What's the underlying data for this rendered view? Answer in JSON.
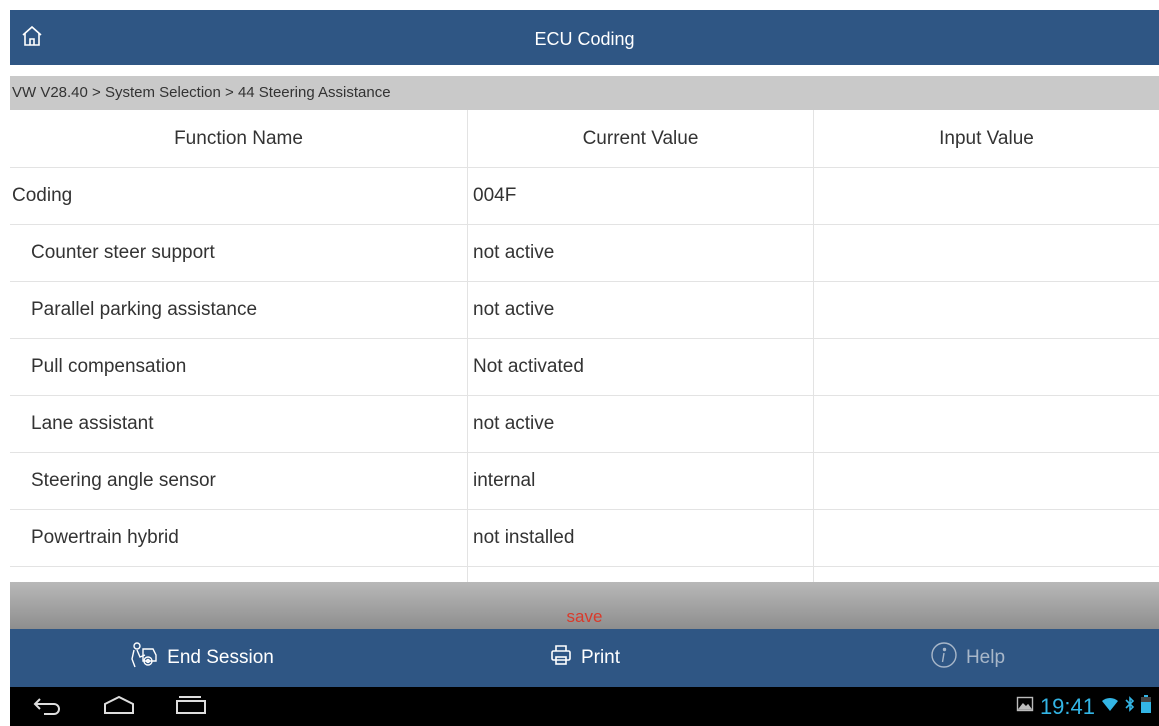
{
  "header": {
    "title": "ECU Coding",
    "home_icon": "home-icon"
  },
  "breadcrumb": "VW V28.40 > System Selection > 44 Steering Assistance",
  "table": {
    "columns": [
      "Function Name",
      "Current Value",
      "Input Value"
    ],
    "rows": [
      {
        "name": "Coding",
        "current": "004F",
        "input": ""
      },
      {
        "name": "Counter steer support",
        "current": "not active",
        "input": ""
      },
      {
        "name": "Parallel parking assistance",
        "current": "not active",
        "input": ""
      },
      {
        "name": "Pull compensation",
        "current": "Not activated",
        "input": ""
      },
      {
        "name": "Lane assistant",
        "current": "not active",
        "input": ""
      },
      {
        "name": "Steering angle sensor",
        "current": "internal",
        "input": ""
      },
      {
        "name": "Powertrain hybrid",
        "current": "not installed",
        "input": ""
      }
    ]
  },
  "save_label": "save",
  "actions": {
    "end_session": "End Session",
    "print": "Print",
    "help": "Help"
  },
  "system": {
    "time": "19:41"
  },
  "colors": {
    "header_bg": "#2f5684",
    "save_text": "#d93a2b",
    "clock": "#33b5e5"
  }
}
